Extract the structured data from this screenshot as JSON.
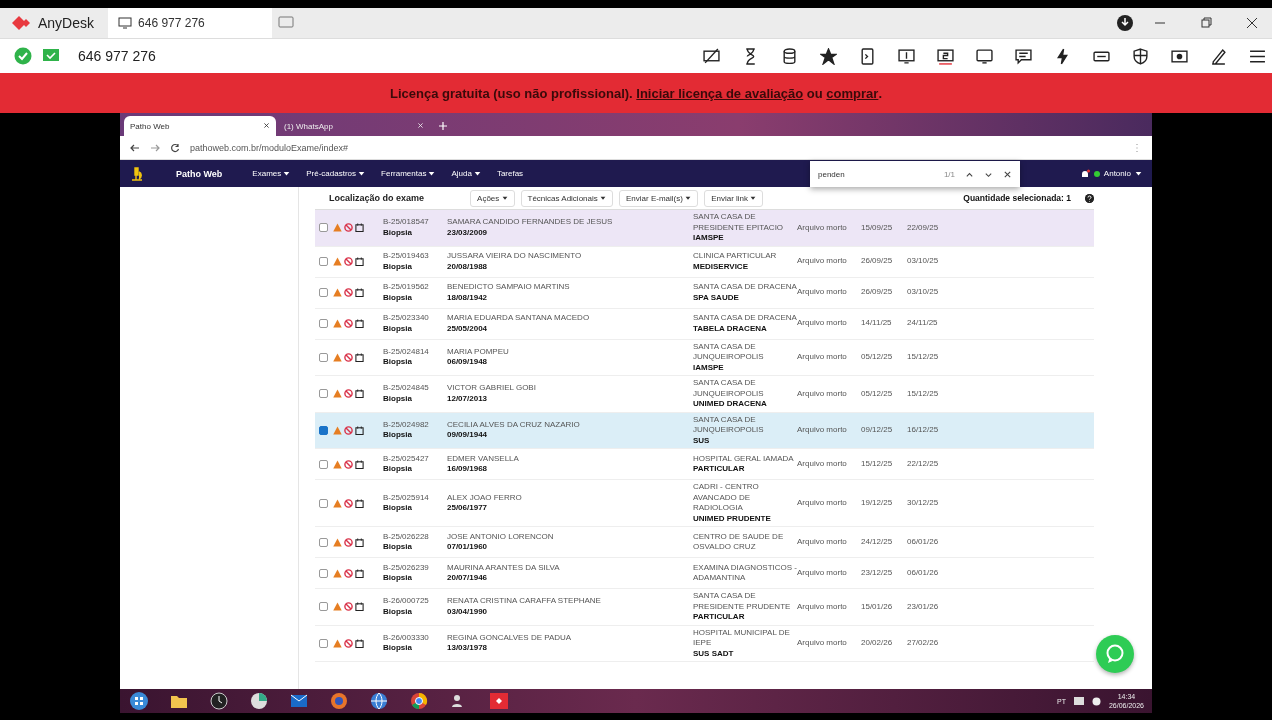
{
  "anydesk": {
    "app_name": "AnyDesk",
    "session_tab": "646 977 276",
    "address": "646 977 276",
    "banner": [
      {
        "kind": "text",
        "text": "Licença gratuita (uso não profissional). "
      },
      {
        "kind": "link",
        "text": "Iniciar licença de avaliação"
      },
      {
        "kind": "text",
        "text": " ou "
      },
      {
        "kind": "link",
        "text": "comprar"
      },
      {
        "kind": "text",
        "text": "."
      }
    ]
  },
  "browser": {
    "tabs": [
      {
        "label": "Patho Web",
        "selected": true
      },
      {
        "label": "(1) WhatsApp",
        "selected": false
      }
    ],
    "url": "pathoweb.com.br/moduloExame/index#",
    "find_bar": {
      "value": "penden",
      "count": "1/1"
    }
  },
  "navbar": {
    "brand": "Patho Web",
    "menus": [
      {
        "label": "Exames",
        "dropdown": true
      },
      {
        "label": "Pré-cadastros",
        "dropdown": true
      },
      {
        "label": "Ferramentas",
        "dropdown": true
      },
      {
        "label": "Ajuda",
        "dropdown": true
      },
      {
        "label": "Tarefas",
        "dropdown": false
      }
    ],
    "user": "Antonio"
  },
  "toolbar": {
    "title": "Localização do exame",
    "buttons": [
      {
        "label": "Ações"
      },
      {
        "label": "Técnicas Adicionais"
      },
      {
        "label": "Enviar E-mail(s)"
      },
      {
        "label": "Enviar link"
      }
    ],
    "selected_count": "Quantidade selecionada: 1"
  },
  "rows": [
    {
      "checked": false,
      "hovered": true,
      "code": "B-25/018547",
      "type": "Biopsia",
      "patient": "SAMARA CANDIDO FERNANDES DE JESUS",
      "birth": "23/03/2009",
      "clinic": "SANTA CASA DE PRESIDENTE EPITACIO",
      "insurer": "IAMSPE",
      "location": "Arquivo morto",
      "date_1": "15/09/25",
      "date_2": "22/09/25"
    },
    {
      "checked": false,
      "hovered": false,
      "code": "B-25/019463",
      "type": "Biopsia",
      "patient": "JUSSARA VIEIRA DO NASCIMENTO",
      "birth": "20/08/1988",
      "clinic": "CLINICA PARTICULAR",
      "insurer": "MEDISERVICE",
      "location": "Arquivo morto",
      "date_1": "26/09/25",
      "date_2": "03/10/25"
    },
    {
      "checked": false,
      "hovered": false,
      "code": "B-25/019562",
      "type": "Biopsia",
      "patient": "BENEDICTO SAMPAIO MARTINS",
      "birth": "18/08/1942",
      "clinic": "SANTA CASA DE DRACENA",
      "insurer": "SPA SAUDE",
      "location": "Arquivo morto",
      "date_1": "26/09/25",
      "date_2": "03/10/25"
    },
    {
      "checked": false,
      "hovered": false,
      "code": "B-25/023340",
      "type": "Biopsia",
      "patient": "MARIA EDUARDA SANTANA MACEDO",
      "birth": "25/05/2004",
      "clinic": "SANTA CASA DE DRACENA",
      "insurer": "TABELA DRACENA",
      "location": "Arquivo morto",
      "date_1": "14/11/25",
      "date_2": "24/11/25"
    },
    {
      "checked": false,
      "hovered": false,
      "code": "B-25/024814",
      "type": "Biopsia",
      "patient": "MARIA POMPEU",
      "birth": "06/09/1948",
      "clinic": "SANTA CASA DE JUNQUEIROPOLIS",
      "insurer": "IAMSPE",
      "location": "Arquivo morto",
      "date_1": "05/12/25",
      "date_2": "15/12/25"
    },
    {
      "checked": false,
      "hovered": false,
      "code": "B-25/024845",
      "type": "Biopsia",
      "patient": "VICTOR GABRIEL GOBI",
      "birth": "12/07/2013",
      "clinic": "SANTA CASA DE JUNQUEIROPOLIS",
      "insurer": "UNIMED DRACENA",
      "location": "Arquivo morto",
      "date_1": "05/12/25",
      "date_2": "15/12/25"
    },
    {
      "checked": true,
      "hovered": false,
      "code": "B-25/024982",
      "type": "Biopsia",
      "patient": "CECILIA ALVES DA CRUZ NAZARIO",
      "birth": "09/09/1944",
      "clinic": "SANTA CASA DE JUNQUEIROPOLIS",
      "insurer": "SUS",
      "location": "Arquivo morto",
      "date_1": "09/12/25",
      "date_2": "16/12/25"
    },
    {
      "checked": false,
      "hovered": false,
      "code": "B-25/025427",
      "type": "Biopsia",
      "patient": "EDMER VANSELLA",
      "birth": "16/09/1968",
      "clinic": "HOSPITAL GERAL IAMADA",
      "insurer": "PARTICULAR",
      "location": "Arquivo morto",
      "date_1": "15/12/25",
      "date_2": "22/12/25"
    },
    {
      "checked": false,
      "hovered": false,
      "code": "B-25/025914",
      "type": "Biopsia",
      "patient": "ALEX JOAO FERRO",
      "birth": "25/06/1977",
      "clinic": "CADRI - CENTRO AVANCADO DE RADIOLOGIA",
      "insurer": "UNIMED PRUDENTE",
      "location": "Arquivo morto",
      "date_1": "19/12/25",
      "date_2": "30/12/25"
    },
    {
      "checked": false,
      "hovered": false,
      "code": "B-25/026228",
      "type": "Biopsia",
      "patient": "JOSE ANTONIO LORENCON",
      "birth": "07/01/1960",
      "clinic": "CENTRO DE SAUDE DE OSVALDO CRUZ",
      "location": "Arquivo morto",
      "date_1": "24/12/25",
      "date_2": "06/01/26"
    },
    {
      "checked": false,
      "hovered": false,
      "code": "B-25/026239",
      "type": "Biopsia",
      "patient": "MAURINA ARANTES DA SILVA",
      "birth": "20/07/1946",
      "clinic": "EXAMINA DIAGNOSTICOS - ADAMANTINA",
      "location": "Arquivo morto",
      "date_1": "23/12/25",
      "date_2": "06/01/26"
    },
    {
      "checked": false,
      "hovered": false,
      "code": "B-26/000725",
      "type": "Biopsia",
      "patient": "RENATA CRISTINA CARAFFA STEPHANE",
      "birth": "03/04/1990",
      "clinic": "SANTA CASA DE PRESIDENTE PRUDENTE",
      "insurer": "PARTICULAR",
      "location": "Arquivo morto",
      "date_1": "15/01/26",
      "date_2": "23/01/26"
    },
    {
      "checked": false,
      "hovered": false,
      "code": "B-26/003330",
      "type": "Biopsia",
      "patient": "REGINA GONCALVES DE PADUA",
      "birth": "13/03/1978",
      "clinic": "HOSPITAL MUNICIPAL DE IEPE",
      "insurer": "SUS SADT",
      "location": "Arquivo morto",
      "date_1": "20/02/26",
      "date_2": "27/02/26"
    }
  ],
  "taskbar": {
    "language": "PT",
    "time": "14:34",
    "date": "26/06/2026"
  }
}
